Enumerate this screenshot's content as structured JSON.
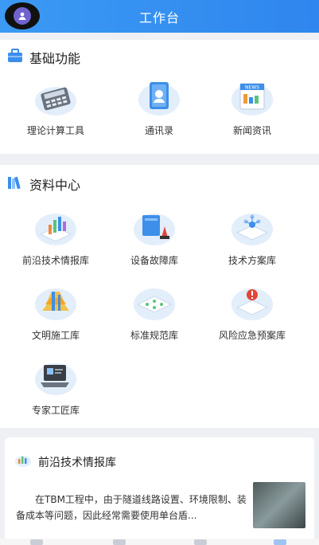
{
  "header": {
    "title": "工作台"
  },
  "basic": {
    "title": "基础功能",
    "items": [
      {
        "label": "理论计算工具",
        "icon": "calculator-icon"
      },
      {
        "label": "通讯录",
        "icon": "contacts-book-icon"
      },
      {
        "label": "新闻资讯",
        "icon": "news-icon",
        "badge": "NEWS"
      }
    ]
  },
  "resources": {
    "title": "资料中心",
    "items": [
      {
        "label": "前沿技术情报库",
        "icon": "bar-chart-icon"
      },
      {
        "label": "设备故障库",
        "icon": "equipment-fault-icon"
      },
      {
        "label": "技术方案库",
        "icon": "tech-scheme-icon"
      },
      {
        "label": "文明施工库",
        "icon": "construction-icon"
      },
      {
        "label": "标准规范库",
        "icon": "standards-icon"
      },
      {
        "label": "风险应急预案库",
        "icon": "risk-warning-icon"
      },
      {
        "label": "专家工匠库",
        "icon": "expert-laptop-icon"
      }
    ]
  },
  "feature": {
    "title": "前沿技术情报库",
    "text": "在TBM工程中，由于隧道线路设置、环境限制、装备成本等问题，因此经常需要使用单台盾..."
  },
  "colors": {
    "primary": "#2f86ee",
    "iconCircle": "#e3eefb",
    "text": "#222222"
  }
}
